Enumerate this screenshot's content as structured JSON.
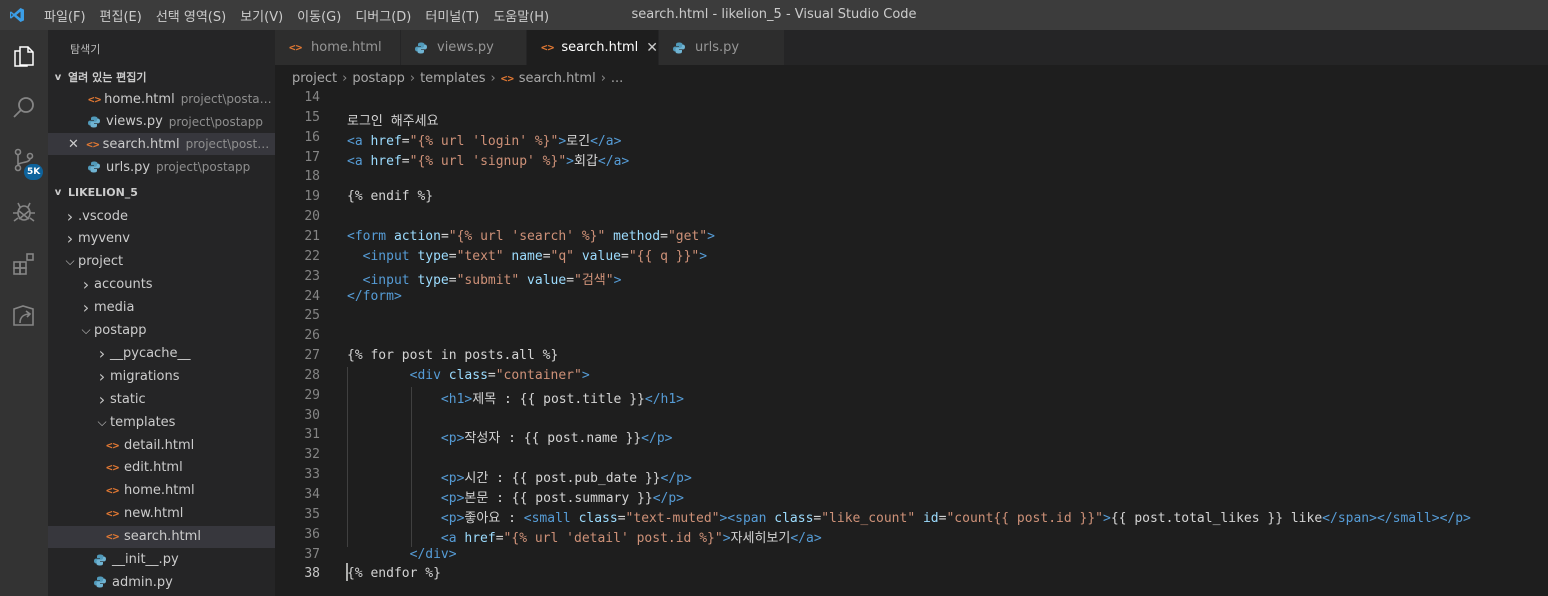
{
  "titlebar": {
    "title": "search.html - likelion_5 - Visual Studio Code",
    "menu": [
      "파일(F)",
      "편집(E)",
      "선택 영역(S)",
      "보기(V)",
      "이동(G)",
      "디버그(D)",
      "터미널(T)",
      "도움말(H)"
    ]
  },
  "activity": {
    "items": [
      "files-icon",
      "search-icon",
      "source-control-icon",
      "debug-icon",
      "extensions-icon",
      "remote-icon"
    ],
    "scm_badge": "5K"
  },
  "sidebar": {
    "title": "탐색기",
    "open_editors": {
      "header": "열려 있는 편집기",
      "items": [
        {
          "label": "home.html",
          "desc": "project\\postapp...",
          "icon": "html"
        },
        {
          "label": "views.py",
          "desc": "project\\postapp",
          "icon": "py"
        },
        {
          "label": "search.html",
          "desc": "project\\postap...",
          "icon": "html"
        },
        {
          "label": "urls.py",
          "desc": "project\\postapp",
          "icon": "py"
        }
      ]
    },
    "workspace": {
      "header": "LIKELION_5",
      "items": [
        {
          "label": ".vscode",
          "type": "folder",
          "depth": 0,
          "open": false
        },
        {
          "label": "myvenv",
          "type": "folder",
          "depth": 0,
          "open": false
        },
        {
          "label": "project",
          "type": "folder",
          "depth": 0,
          "open": true
        },
        {
          "label": "accounts",
          "type": "folder",
          "depth": 1,
          "open": false
        },
        {
          "label": "media",
          "type": "folder",
          "depth": 1,
          "open": false
        },
        {
          "label": "postapp",
          "type": "folder",
          "depth": 1,
          "open": true
        },
        {
          "label": "__pycache__",
          "type": "folder",
          "depth": 2,
          "open": false
        },
        {
          "label": "migrations",
          "type": "folder",
          "depth": 2,
          "open": false
        },
        {
          "label": "static",
          "type": "folder",
          "depth": 2,
          "open": false
        },
        {
          "label": "templates",
          "type": "folder",
          "depth": 2,
          "open": true
        },
        {
          "label": "detail.html",
          "type": "html",
          "depth": 3
        },
        {
          "label": "edit.html",
          "type": "html",
          "depth": 3
        },
        {
          "label": "home.html",
          "type": "html",
          "depth": 3
        },
        {
          "label": "new.html",
          "type": "html",
          "depth": 3
        },
        {
          "label": "search.html",
          "type": "html",
          "depth": 3
        },
        {
          "label": "__init__.py",
          "type": "py",
          "depth": 2
        },
        {
          "label": "admin.py",
          "type": "py",
          "depth": 2
        }
      ]
    }
  },
  "tabs": [
    {
      "label": "home.html",
      "icon": "html",
      "active": false
    },
    {
      "label": "views.py",
      "icon": "py",
      "active": false
    },
    {
      "label": "search.html",
      "icon": "html",
      "active": true,
      "close": "✕"
    },
    {
      "label": "urls.py",
      "icon": "py",
      "active": false
    }
  ],
  "breadcrumb": [
    "project",
    "postapp",
    "templates",
    "search.html",
    "..."
  ],
  "editor": {
    "current_line": 38,
    "lines": [
      {
        "n": 14,
        "c": []
      },
      {
        "n": 15,
        "c": [
          [
            "",
            "로그인 해주세요"
          ]
        ]
      },
      {
        "n": 16,
        "c": [
          [
            "t",
            "<a "
          ],
          [
            "a",
            "href"
          ],
          [
            "",
            "="
          ],
          [
            "s",
            "\"{% url 'login' %}\""
          ],
          [
            "t",
            ">"
          ],
          [
            "",
            "로긴"
          ],
          [
            "t",
            "</a>"
          ]
        ]
      },
      {
        "n": 17,
        "c": [
          [
            "t",
            "<a "
          ],
          [
            "a",
            "href"
          ],
          [
            "",
            "="
          ],
          [
            "s",
            "\"{% url 'signup' %}\""
          ],
          [
            "t",
            ">"
          ],
          [
            "",
            "회갑"
          ],
          [
            "t",
            "</a>"
          ]
        ]
      },
      {
        "n": 18,
        "c": []
      },
      {
        "n": 19,
        "c": [
          [
            "",
            "{% endif %}"
          ]
        ]
      },
      {
        "n": 20,
        "c": []
      },
      {
        "n": 21,
        "c": [
          [
            "t",
            "<form "
          ],
          [
            "a",
            "action"
          ],
          [
            "",
            "="
          ],
          [
            "s",
            "\"{% url 'search' %}\""
          ],
          [
            "",
            ""
          ],
          [
            "a",
            " method"
          ],
          [
            "",
            "="
          ],
          [
            "s",
            "\"get\""
          ],
          [
            "t",
            ">"
          ]
        ]
      },
      {
        "n": 22,
        "c": [
          [
            "",
            "  "
          ],
          [
            "t",
            "<input "
          ],
          [
            "a",
            "type"
          ],
          [
            "",
            "="
          ],
          [
            "s",
            "\"text\""
          ],
          [
            "a",
            " name"
          ],
          [
            "",
            "="
          ],
          [
            "s",
            "\"q\""
          ],
          [
            "a",
            " value"
          ],
          [
            "",
            "="
          ],
          [
            "s",
            "\"{{ q }}\""
          ],
          [
            "t",
            ">"
          ]
        ]
      },
      {
        "n": 23,
        "c": [
          [
            "",
            "  "
          ],
          [
            "t",
            "<input "
          ],
          [
            "a",
            "type"
          ],
          [
            "",
            "="
          ],
          [
            "s",
            "\"submit\""
          ],
          [
            "a",
            " value"
          ],
          [
            "",
            "="
          ],
          [
            "s",
            "\"검색\""
          ],
          [
            "t",
            ">"
          ]
        ]
      },
      {
        "n": 24,
        "c": [
          [
            "t",
            "</form>"
          ]
        ]
      },
      {
        "n": 25,
        "c": []
      },
      {
        "n": 26,
        "c": []
      },
      {
        "n": 27,
        "c": [
          [
            "",
            "{% for post in posts.all %}"
          ]
        ]
      },
      {
        "n": 28,
        "c": [
          [
            "",
            "        "
          ],
          [
            "t",
            "<div "
          ],
          [
            "a",
            "class"
          ],
          [
            "",
            "="
          ],
          [
            "s",
            "\"container\""
          ],
          [
            "t",
            ">"
          ]
        ]
      },
      {
        "n": 29,
        "c": [
          [
            "",
            "            "
          ],
          [
            "t",
            "<h1>"
          ],
          [
            "",
            "제목 : {{ post.title }}"
          ],
          [
            "t",
            "</h1>"
          ]
        ]
      },
      {
        "n": 30,
        "c": []
      },
      {
        "n": 31,
        "c": [
          [
            "",
            "            "
          ],
          [
            "t",
            "<p>"
          ],
          [
            "",
            "작성자 : {{ post.name }}"
          ],
          [
            "t",
            "</p>"
          ]
        ]
      },
      {
        "n": 32,
        "c": []
      },
      {
        "n": 33,
        "c": [
          [
            "",
            "            "
          ],
          [
            "t",
            "<p>"
          ],
          [
            "",
            "시간 : {{ post.pub_date }}"
          ],
          [
            "t",
            "</p>"
          ]
        ]
      },
      {
        "n": 34,
        "c": [
          [
            "",
            "            "
          ],
          [
            "t",
            "<p>"
          ],
          [
            "",
            "본문 : {{ post.summary }}"
          ],
          [
            "t",
            "</p>"
          ]
        ]
      },
      {
        "n": 35,
        "c": [
          [
            "",
            "            "
          ],
          [
            "t",
            "<p>"
          ],
          [
            "",
            "좋아요 : "
          ],
          [
            "t",
            "<small "
          ],
          [
            "a",
            "class"
          ],
          [
            "",
            "="
          ],
          [
            "s",
            "\"text-muted\""
          ],
          [
            "t",
            "><span "
          ],
          [
            "a",
            "class"
          ],
          [
            "",
            "="
          ],
          [
            "s",
            "\"like_count\""
          ],
          [
            "a",
            " id"
          ],
          [
            "",
            "="
          ],
          [
            "s",
            "\"count{{ post.id }}\""
          ],
          [
            "t",
            ">"
          ],
          [
            "",
            "{{ post.total_likes }} like"
          ],
          [
            "t",
            "</span></small></p>"
          ]
        ]
      },
      {
        "n": 36,
        "c": [
          [
            "",
            "            "
          ],
          [
            "t",
            "<a "
          ],
          [
            "a",
            "href"
          ],
          [
            "",
            "="
          ],
          [
            "s",
            "\"{% url 'detail' post.id %}\""
          ],
          [
            "t",
            ">"
          ],
          [
            "",
            "자세히보기"
          ],
          [
            "t",
            "</a>"
          ]
        ]
      },
      {
        "n": 37,
        "c": [
          [
            "",
            "        "
          ],
          [
            "t",
            "</div>"
          ]
        ]
      },
      {
        "n": 38,
        "c": [
          [
            "",
            "{% endfor %}"
          ]
        ]
      }
    ]
  },
  "colors": {
    "accent": "#007acc",
    "badge": "#0e639c",
    "html_icon": "#e37933",
    "py_icon": "#519aba"
  }
}
